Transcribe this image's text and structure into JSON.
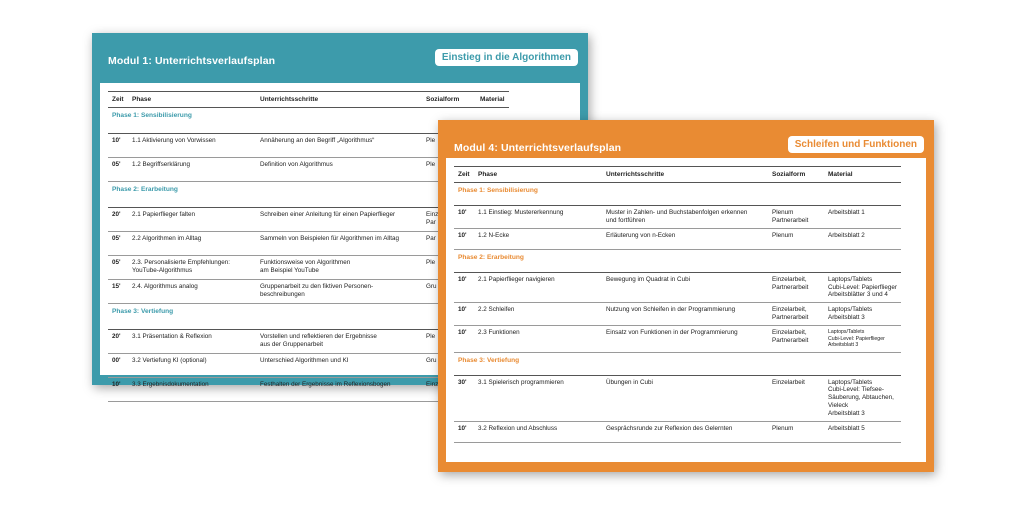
{
  "teal": {
    "title": "Modul 1: Unterrichtsverlaufsplan",
    "badge": "Einstieg in die Algorithmen",
    "headers": [
      "Zeit",
      "Phase",
      "Unterrichtsschritte",
      "Sozialform",
      "Material"
    ],
    "rows": [
      {
        "type": "phase",
        "label": "Phase 1: Sensibilisierung"
      },
      {
        "type": "row",
        "zeit": "10'",
        "phase": "1.1 Aktivierung von Vorwissen",
        "schritte": "Annäherung an den Begriff „Algorithmus“",
        "sozial": "Ple",
        "material": ""
      },
      {
        "type": "row",
        "zeit": "05'",
        "phase": "1.2 Begriffserklärung",
        "schritte": "Definition von Algorithmus",
        "sozial": "Ple",
        "material": ""
      },
      {
        "type": "phase",
        "label": "Phase 2: Erarbeitung"
      },
      {
        "type": "row",
        "zeit": "20'",
        "phase": "2.1 Papierflieger falten",
        "schritte": "Schreiben einer Anleitung für einen Papierflieger",
        "sozial": "Einz\nPar",
        "material": ""
      },
      {
        "type": "row",
        "zeit": "05'",
        "phase": "2.2 Algorithmen im Alltag",
        "schritte": "Sammeln von Beispielen für Algorithmen im Alltag",
        "sozial": "Par",
        "material": ""
      },
      {
        "type": "row",
        "zeit": "05'",
        "phase": "2.3. Personalisierte Empfehlungen:\nYouTube-Algorithmus",
        "schritte": "Funktionsweise von Algorithmen\nam Beispiel YouTube",
        "sozial": "Ple",
        "material": ""
      },
      {
        "type": "row",
        "zeit": "15'",
        "phase": "2.4. Algorithmus analog",
        "schritte": "Gruppenarbeit zu den fiktiven Personen-\nbeschreibungen",
        "sozial": "Gru",
        "material": ""
      },
      {
        "type": "phase",
        "label": "Phase 3: Vertiefung"
      },
      {
        "type": "row",
        "zeit": "20'",
        "phase": "3.1 Präsentation & Reflexion",
        "schritte": "Vorstellen und reflektieren der Ergebnisse\naus der Gruppenarbeit",
        "sozial": "Ple",
        "material": ""
      },
      {
        "type": "row",
        "zeit": "00'",
        "phase": "3.2 Vertiefung KI (optional)",
        "schritte": "Unterschied Algorithmen und KI",
        "sozial": "Gru",
        "material": ""
      },
      {
        "type": "row",
        "zeit": "10'",
        "phase": "3.3 Ergebnisdokumentation",
        "schritte": "Festhalten der Ergebnisse im Reflexionsbogen",
        "sozial": "Einz",
        "material": ""
      }
    ]
  },
  "orange": {
    "title": "Modul 4: Unterrichtsverlaufsplan",
    "badge": "Schleifen und Funktionen",
    "headers": [
      "Zeit",
      "Phase",
      "Unterrichtsschritte",
      "Sozialform",
      "Material"
    ],
    "rows": [
      {
        "type": "phase",
        "label": "Phase 1: Sensibilisierung"
      },
      {
        "type": "row",
        "zeit": "10'",
        "phase": "1.1 Einstieg: Mustererkennung",
        "schritte": "Muster in Zahlen- und Buchstabenfolgen erkennen\nund fortführen",
        "sozial": "Plenum\nPartnerarbeit",
        "material": "Arbeitsblatt 1"
      },
      {
        "type": "row",
        "zeit": "10'",
        "phase": "1.2 N-Ecke",
        "schritte": "Erläuterung von n-Ecken",
        "sozial": "Plenum",
        "material": "Arbeitsblatt 2"
      },
      {
        "type": "phase",
        "label": "Phase 2: Erarbeitung"
      },
      {
        "type": "row",
        "zeit": "10'",
        "phase": "2.1 Papierflieger navigieren",
        "schritte": "Bewegung im Quadrat in Cubi",
        "sozial": "Einzelarbeit,\nPartnerarbeit",
        "material": "Laptops/Tablets\nCubi-Level: Papierflieger\nArbeitsblätter 3 und 4"
      },
      {
        "type": "row",
        "zeit": "10'",
        "phase": "2.2 Schleifen",
        "schritte": "Nutzung von Schleifen in der Programmierung",
        "sozial": "Einzelarbeit,\nPartnerarbeit",
        "material": "Laptops/Tablets\nArbeitsblatt 3"
      },
      {
        "type": "row",
        "zeit": "10'",
        "phase": "2.3 Funktionen",
        "schritte": "Einsatz von Funktionen in der Programmierung",
        "sozial": "Einzelarbeit,\nPartnerarbeit",
        "material": "Laptops/Tablets\nCubi-Level: Papierflieger\nArbeitsblatt 3",
        "small_material": true
      },
      {
        "type": "phase",
        "label": "Phase 3: Vertiefung"
      },
      {
        "type": "row",
        "zeit": "30'",
        "phase": "3.1 Spielerisch programmieren",
        "schritte": "Übungen in Cubi",
        "sozial": "Einzelarbeit",
        "material": "Laptops/Tablets\nCubi-Level: Tiefsee-\nSäuberung, Abtauchen,\nVieleck\nArbeitsblatt 3"
      },
      {
        "type": "row",
        "zeit": "10'",
        "phase": "3.2 Reflexion und Abschluss",
        "schritte": "Gesprächsrunde zur Reflexion des Gelernten",
        "sozial": "Plenum",
        "material": "Arbeitsblatt 5"
      }
    ]
  }
}
